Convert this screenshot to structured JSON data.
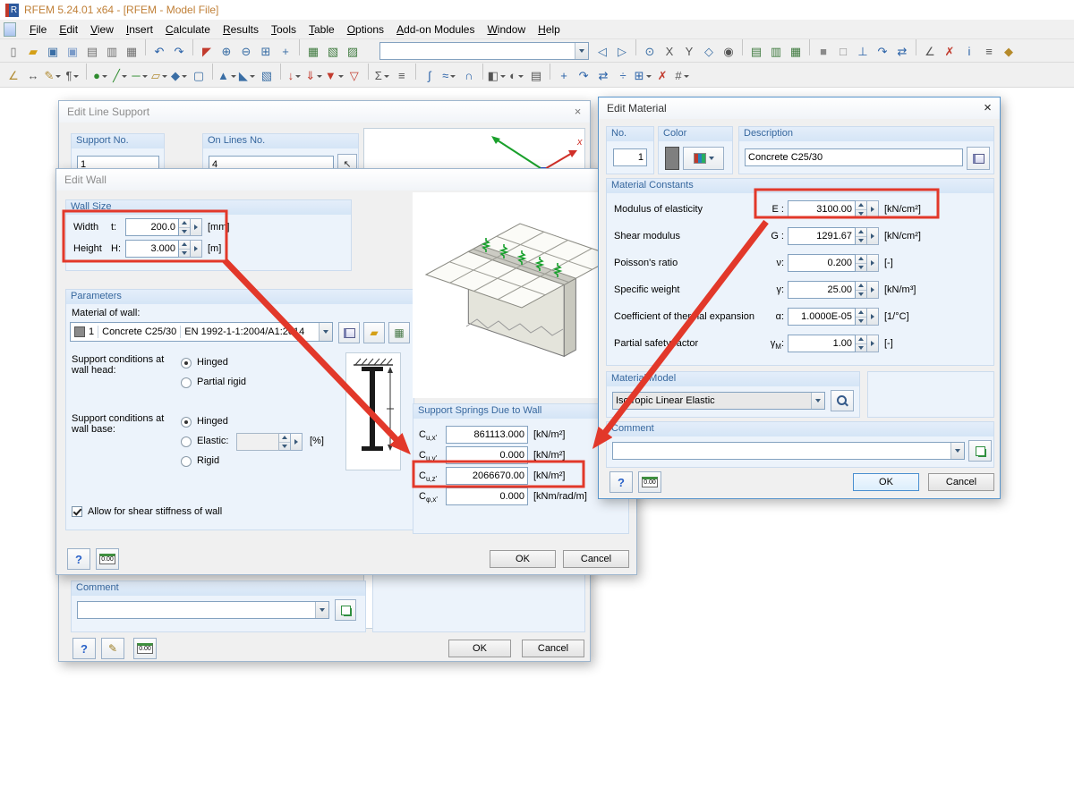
{
  "window": {
    "title": "RFEM 5.24.01 x64 - [RFEM - Model File]"
  },
  "menu": {
    "items": [
      "File",
      "Edit",
      "View",
      "Insert",
      "Calculate",
      "Results",
      "Tools",
      "Table",
      "Options",
      "Add-on Modules",
      "Window",
      "Help"
    ]
  },
  "colors": {
    "annotation_red": "#e2382a",
    "group_header_blue": "#36679e",
    "title_text_orange": "#c08038"
  },
  "toolbar": {
    "combo_value": "",
    "row1_left": [
      {
        "n": "new-model-icon",
        "g": "▯",
        "c": "#707070"
      },
      {
        "n": "open-model-icon",
        "g": "▰",
        "c": "#d4a017"
      },
      {
        "n": "save-icon",
        "g": "▣",
        "c": "#3a6ea5"
      },
      {
        "n": "save-all-icon",
        "g": "▣",
        "c": "#7a9ac8"
      },
      {
        "n": "print-icon",
        "g": "▤",
        "c": "#707070"
      },
      {
        "n": "print-preview-icon",
        "g": "▥",
        "c": "#707070"
      },
      {
        "n": "printout-report-icon",
        "g": "▦",
        "c": "#707070"
      },
      {
        "sep": true
      },
      {
        "n": "undo-icon",
        "g": "↶",
        "c": "#2a62a8"
      },
      {
        "n": "redo-icon",
        "g": "↷",
        "c": "#2a62a8"
      },
      {
        "sep": true
      },
      {
        "n": "guide-corner-icon",
        "g": "◤",
        "c": "#c23b2e"
      },
      {
        "n": "zoom-in-icon",
        "g": "⊕",
        "c": "#3a6ea5"
      },
      {
        "n": "zoom-out-icon",
        "g": "⊖",
        "c": "#3a6ea5"
      },
      {
        "n": "zoom-window-icon",
        "g": "⊞",
        "c": "#3a6ea5"
      },
      {
        "n": "pan-icon",
        "g": "+",
        "c": "#3a6ea5"
      },
      {
        "sep": true
      },
      {
        "n": "show-tables-icon",
        "g": "▦",
        "c": "#3f7a3f"
      },
      {
        "n": "edit-tables-icon",
        "g": "▧",
        "c": "#3f7a3f"
      },
      {
        "n": "project-navigator-icon",
        "g": "▨",
        "c": "#3f7a3f"
      }
    ],
    "row1_right": [
      {
        "n": "back-view-icon",
        "g": "◁",
        "c": "#3a6ea5"
      },
      {
        "n": "forward-view-icon",
        "g": "▷",
        "c": "#3a6ea5"
      },
      {
        "sep": true
      },
      {
        "n": "zoom-select-icon",
        "g": "⊙",
        "c": "#3a6ea5"
      },
      {
        "n": "axes-x-icon",
        "g": "X",
        "c": "#555555"
      },
      {
        "n": "axes-y-icon",
        "g": "Y",
        "c": "#555555"
      },
      {
        "n": "isometric-view-icon",
        "g": "◇",
        "c": "#3a6ea5"
      },
      {
        "n": "camera-icon",
        "g": "◉",
        "c": "#555555"
      },
      {
        "sep": true
      },
      {
        "n": "table-layout-icon",
        "g": "▤",
        "c": "#3f7a3f"
      },
      {
        "n": "table-filter-icon",
        "g": "▥",
        "c": "#3f7a3f"
      },
      {
        "n": "table-export-icon",
        "g": "▦",
        "c": "#3f7a3f"
      },
      {
        "sep": true
      },
      {
        "n": "render-solid-icon",
        "g": "■",
        "c": "#8a8a8a"
      },
      {
        "n": "render-wire-icon",
        "g": "□",
        "c": "#8a8a8a"
      },
      {
        "n": "show-axes-icon",
        "g": "⊥",
        "c": "#2a62a8"
      },
      {
        "n": "rotate-view-icon",
        "g": "↷",
        "c": "#2a62a8"
      },
      {
        "n": "mirror-view-icon",
        "g": "⇄",
        "c": "#2a62a8"
      },
      {
        "sep": true
      },
      {
        "n": "measure-icon",
        "g": "∠",
        "c": "#555555"
      },
      {
        "n": "delete-results-icon",
        "g": "✗",
        "c": "#c23b2e"
      },
      {
        "n": "info-icon",
        "g": "i",
        "c": "#2a62a8"
      },
      {
        "n": "settings-icon",
        "g": "≡",
        "c": "#555555"
      },
      {
        "n": "full-view-icon",
        "g": "◆",
        "c": "#b58a2a"
      }
    ],
    "row2": [
      {
        "n": "guideline-icon",
        "g": "∠",
        "c": "#b08a30"
      },
      {
        "n": "dimension-icon",
        "g": "↔",
        "c": "#555555"
      },
      {
        "n": "annotation-icon",
        "g": "✎",
        "c": "#b08a30",
        "d": 1
      },
      {
        "n": "comment-tool-icon",
        "g": "¶",
        "c": "#555555",
        "d": 1
      },
      {
        "sep": true
      },
      {
        "n": "node-icon",
        "g": "●",
        "c": "#2e8b2e",
        "d": 1
      },
      {
        "n": "line-tool-icon",
        "g": "╱",
        "c": "#2e8b2e",
        "d": 1
      },
      {
        "n": "member-icon",
        "g": "─",
        "c": "#2e8b2e",
        "d": 1
      },
      {
        "n": "surface-icon",
        "g": "▱",
        "c": "#b08a30",
        "d": 1
      },
      {
        "n": "solid-icon",
        "g": "◆",
        "c": "#3a6ea5",
        "d": 1
      },
      {
        "n": "opening-icon",
        "g": "▢",
        "c": "#3a6ea5"
      },
      {
        "sep": true
      },
      {
        "n": "nodal-support-icon",
        "g": "▲",
        "c": "#3a6ea5",
        "d": 1
      },
      {
        "n": "line-support-icon",
        "g": "◣",
        "c": "#3a6ea5",
        "d": 1
      },
      {
        "n": "surface-support-icon",
        "g": "▧",
        "c": "#3a6ea5"
      },
      {
        "sep": true
      },
      {
        "n": "nodal-load-icon",
        "g": "↓",
        "c": "#c23b2e",
        "d": 1
      },
      {
        "n": "member-load-icon",
        "g": "⇓",
        "c": "#c23b2e",
        "d": 1
      },
      {
        "n": "area-load-icon",
        "g": "▼",
        "c": "#c23b2e",
        "d": 1
      },
      {
        "n": "free-load-icon",
        "g": "▽",
        "c": "#c23b2e"
      },
      {
        "sep": true
      },
      {
        "n": "load-case-icon",
        "g": "Σ",
        "c": "#555555",
        "d": 1
      },
      {
        "n": "combinations-icon",
        "g": "≡",
        "c": "#555555"
      },
      {
        "sep": true
      },
      {
        "n": "calculate-icon",
        "g": "∫",
        "c": "#2a62a8"
      },
      {
        "n": "results-icon",
        "g": "≈",
        "c": "#2a62a8",
        "d": 1
      },
      {
        "n": "deformation-icon",
        "g": "∩",
        "c": "#2a62a8"
      },
      {
        "sep": true
      },
      {
        "n": "section-icon",
        "g": "◧",
        "c": "#555555",
        "d": 1
      },
      {
        "n": "visibility-icon",
        "g": "◐",
        "c": "#555555",
        "d": 1
      },
      {
        "n": "user-profile-icon",
        "g": "▤",
        "c": "#555555"
      },
      {
        "sep": true
      },
      {
        "n": "move-copy-icon",
        "g": "+",
        "c": "#2a62a8"
      },
      {
        "n": "rotate-icon",
        "g": "↷",
        "c": "#2a62a8"
      },
      {
        "n": "mirror-icon",
        "g": "⇄",
        "c": "#2a62a8"
      },
      {
        "n": "divide-icon",
        "g": "÷",
        "c": "#2a62a8"
      },
      {
        "n": "connect-icon",
        "g": "⊞",
        "c": "#2a62a8",
        "d": 1
      },
      {
        "n": "delete-icon",
        "g": "✗",
        "c": "#c23b2e"
      },
      {
        "n": "renumber-icon",
        "g": "#",
        "c": "#555555",
        "d": 1
      }
    ]
  },
  "edit_line_support": {
    "title": "Edit Line Support",
    "close": "×",
    "support_no": {
      "label": "Support No.",
      "value": "1"
    },
    "on_lines": {
      "label": "On Lines No.",
      "value": "4"
    },
    "axis_x_label": "x",
    "comment": {
      "label": "Comment",
      "value": ""
    },
    "buttons": {
      "ok": "OK",
      "cancel": "Cancel"
    }
  },
  "edit_wall": {
    "title": "Edit Wall",
    "wall_size": {
      "title": "Wall Size",
      "width": {
        "label": "Width",
        "symbol": "t:",
        "value": "200.0",
        "unit": "[mm]"
      },
      "height": {
        "label": "Height",
        "symbol": "H:",
        "value": "3.000",
        "unit": "[m]"
      }
    },
    "parameters": {
      "title": "Parameters",
      "material_label": "Material of wall:",
      "material": {
        "no": "1",
        "name": "Concrete C25/30",
        "standard": "EN 1992-1-1:2004/A1:2014"
      },
      "head_label": "Support conditions at wall head:",
      "head_options": [
        {
          "label": "Hinged",
          "selected": true
        },
        {
          "label": "Partial rigid",
          "selected": false
        }
      ],
      "base_label": "Support conditions at wall base:",
      "base_options": [
        {
          "label": "Hinged",
          "selected": true
        },
        {
          "label": "Elastic:",
          "selected": false
        },
        {
          "label": "Rigid",
          "selected": false
        }
      ],
      "elastic_value": "",
      "elastic_unit": "[%]",
      "shear_checkbox": {
        "label": "Allow for shear stiffness of wall",
        "checked": true
      }
    },
    "springs": {
      "title": "Support Springs Due to Wall",
      "rows": [
        {
          "symbol": "C",
          "sub": "u,x'",
          "value": "861113.000",
          "unit": "[kN/m²]"
        },
        {
          "symbol": "C",
          "sub": "u,y'",
          "value": "0.000",
          "unit": "[kN/m²]"
        },
        {
          "symbol": "C",
          "sub": "u,z'",
          "value": "2066670.00",
          "unit": "[kN/m²]"
        },
        {
          "symbol": "C",
          "sub": "φ,x'",
          "value": "0.000",
          "unit": "[kNm/rad/m]"
        }
      ]
    },
    "buttons": {
      "ok": "OK",
      "cancel": "Cancel"
    }
  },
  "edit_material": {
    "title": "Edit Material",
    "close": "×",
    "no": {
      "label": "No.",
      "value": "1"
    },
    "color_label": "Color",
    "description": {
      "label": "Description",
      "value": "Concrete C25/30"
    },
    "constants": {
      "title": "Material Constants",
      "rows": [
        {
          "label": "Modulus of elasticity",
          "symbol": "E",
          "sub": "",
          "value": "3100.00",
          "unit": "[kN/cm²]"
        },
        {
          "label": "Shear modulus",
          "symbol": "G",
          "sub": "",
          "value": "1291.67",
          "unit": "[kN/cm²]"
        },
        {
          "label": "Poisson's ratio",
          "symbol": "ν",
          "sub": "",
          "value": "0.200",
          "unit": "[-]"
        },
        {
          "label": "Specific weight",
          "symbol": "γ",
          "sub": "",
          "value": "25.00",
          "unit": "[kN/m³]"
        },
        {
          "label": "Coefficient of thermal expansion",
          "symbol": "α",
          "sub": "",
          "value": "1.0000E-05",
          "unit": "[1/°C]"
        },
        {
          "label": "Partial safety factor",
          "symbol": "γ",
          "sub": "M",
          "value": "1.00",
          "unit": "[-]"
        }
      ]
    },
    "material_model": {
      "title": "Material Model",
      "value": "Isotropic Linear Elastic"
    },
    "comment": {
      "label": "Comment",
      "value": ""
    },
    "buttons": {
      "ok": "OK",
      "cancel": "Cancel"
    }
  }
}
